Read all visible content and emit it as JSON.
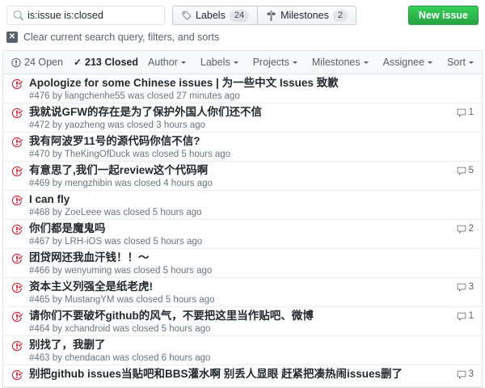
{
  "topbar": {
    "search": {
      "value": "is:issue is:closed"
    },
    "labels_button": {
      "label": "Labels",
      "count": "24"
    },
    "milestones_button": {
      "label": "Milestones",
      "count": "2"
    },
    "new_issue_label": "New issue"
  },
  "clear_link": "Clear current search query, filters, and sorts",
  "issues_header": {
    "open_tab": "24 Open",
    "closed_tab": "213 Closed",
    "filters": [
      "Author",
      "Labels",
      "Projects",
      "Milestones",
      "Assignee",
      "Sort"
    ]
  },
  "issues": [
    {
      "title": "Apologize for some Chinese issues | 为一些中文 Issues 致歉",
      "meta": "#476 by liangchenhe55 was closed 27 minutes ago",
      "comments": null
    },
    {
      "title": "我就说GFW的存在是为了保护外国人你们还不信",
      "meta": "#472 by yaozheng was closed 3 hours ago",
      "comments": "1"
    },
    {
      "title": "我有阿波罗11号的源代码你信不信?",
      "meta": "#470 by TheKingOfDuck was closed 5 hours ago",
      "comments": null
    },
    {
      "title": "有意思了,我们一起review这个代码啊",
      "meta": "#469 by mengzhibin was closed 4 hours ago",
      "comments": "5"
    },
    {
      "title": "I can fly",
      "meta": "#468 by ZoeLeee was closed 5 hours ago",
      "comments": null
    },
    {
      "title": "你们都是魔鬼吗",
      "meta": "#467 by LRH-iOS was closed 5 hours ago",
      "comments": "2"
    },
    {
      "title": "团贷网还我血汗钱！！～",
      "meta": "#466 by wenyuming was closed 5 hours ago",
      "comments": null
    },
    {
      "title": "资本主义列强全是纸老虎!",
      "meta": "#465 by MustangYM was closed 5 hours ago",
      "comments": "3"
    },
    {
      "title": "请你们不要破坏github的风气，不要把这里当作贴吧、微博",
      "meta": "#464 by xchandroid was closed 5 hours ago",
      "comments": "1"
    },
    {
      "title": "别找了，我删了",
      "meta": "#463 by chendacan was closed 6 hours ago",
      "comments": null
    },
    {
      "title": "别把github issues当贴吧和BBS灌水啊 别丢人显眼 赶紧把凑热闹issues删了",
      "meta": "",
      "comments": "3"
    }
  ],
  "colors": {
    "accent_green": "#28a745",
    "closed_red": "#cb2431",
    "header_bg": "#f6f8fa",
    "border": "#e1e4e8",
    "muted_text": "#586069"
  }
}
